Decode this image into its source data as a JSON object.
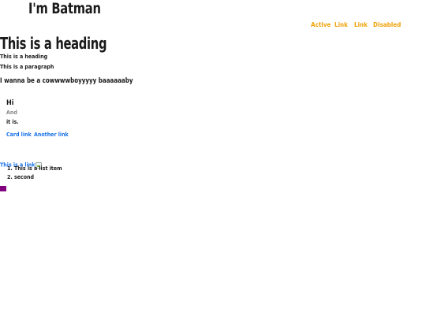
{
  "navbar": {
    "brand": "I'm Batman",
    "links": [
      {
        "label": "Active"
      },
      {
        "label": "Link"
      },
      {
        "label": "Link"
      },
      {
        "label": "Disabled"
      }
    ]
  },
  "content": {
    "heading": "This is a heading",
    "small_heading": "This is a heading",
    "paragraph": "This is a paragraph",
    "lead": "I wanna be a cowwwwboyyyyy baaaaaaby"
  },
  "card": {
    "title": "Hi",
    "subtitle": "And",
    "text": "it is.",
    "links": [
      "Card link",
      "Another link"
    ]
  },
  "link_row": {
    "link_text": "This is a link"
  },
  "ordered_list": {
    "items": [
      "1. This is a list item",
      "2. second"
    ]
  },
  "colors": {
    "nav_link": "#f0a30a",
    "link": "#1a73e8",
    "swatch": "#800080"
  }
}
